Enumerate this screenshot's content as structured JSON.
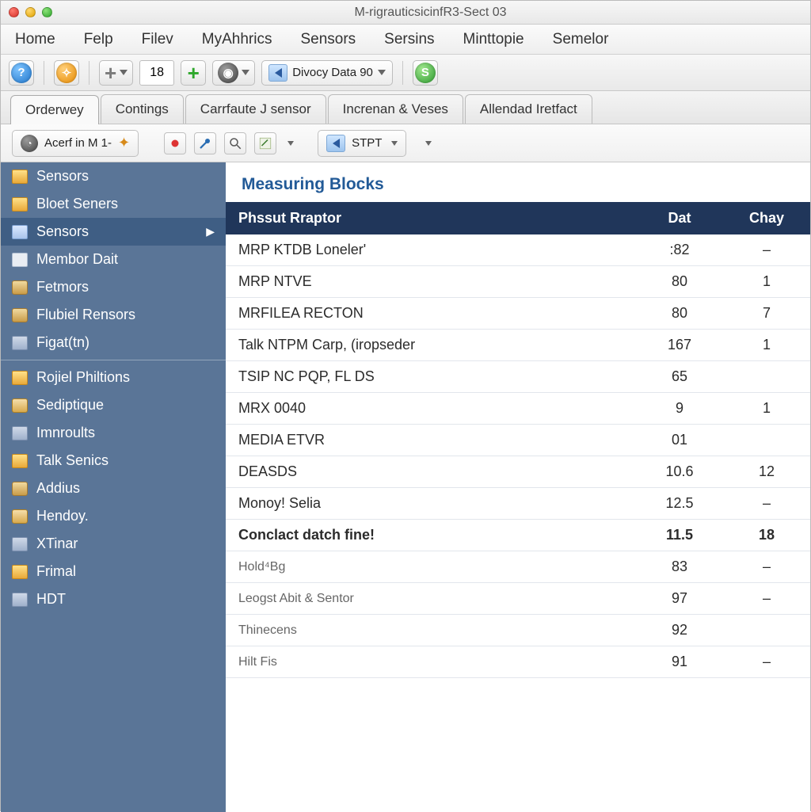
{
  "window": {
    "title": "M-rigrauticsicinfR3-Sect 03"
  },
  "menubar": [
    "Home",
    "Felp",
    "Filev",
    "MyAhhrics",
    "Sensors",
    "Sersins",
    "Minttopie",
    "Semelor"
  ],
  "toolbar1": {
    "step_value": "18",
    "data_dropdown": "Divocy Data 90"
  },
  "tabs": [
    {
      "label": "Orderwey",
      "active": true
    },
    {
      "label": "Contings",
      "active": false
    },
    {
      "label": "Carrfaute J sensor",
      "active": false
    },
    {
      "label": "Increnan & Veses",
      "active": false
    },
    {
      "label": "Allendad Iretfact",
      "active": false
    }
  ],
  "toolbar2": {
    "context_label": "Acerf in M 1-",
    "stpt_label": "STPT"
  },
  "sidebar": {
    "groups": [
      [
        {
          "label": "Sensors",
          "icon": "folder-y",
          "selected": false,
          "expand": false
        },
        {
          "label": "Bloet Seners",
          "icon": "folder-y",
          "selected": false,
          "expand": false
        },
        {
          "label": "Sensors",
          "icon": "folder-b",
          "selected": true,
          "expand": true
        },
        {
          "label": "Membor Dait",
          "icon": "doc",
          "selected": false,
          "expand": false
        },
        {
          "label": "Fetmors",
          "icon": "cube",
          "selected": false,
          "expand": false
        },
        {
          "label": "Flubiel Rensors",
          "icon": "cube",
          "selected": false,
          "expand": false
        },
        {
          "label": "Figat(tn)",
          "icon": "stack",
          "selected": false,
          "expand": false
        }
      ],
      [
        {
          "label": "Rojiel Philtions",
          "icon": "folder-y",
          "selected": false,
          "expand": false
        },
        {
          "label": "Sediptique",
          "icon": "lock",
          "selected": false,
          "expand": false
        },
        {
          "label": "Imnroults",
          "icon": "stack",
          "selected": false,
          "expand": false
        },
        {
          "label": "Talk Senics",
          "icon": "folder-y",
          "selected": false,
          "expand": false
        },
        {
          "label": "Addius",
          "icon": "cube",
          "selected": false,
          "expand": false
        },
        {
          "label": "Hendoy.",
          "icon": "lock",
          "selected": false,
          "expand": false
        },
        {
          "label": "XTinar",
          "icon": "stack",
          "selected": false,
          "expand": false
        },
        {
          "label": "Frimal",
          "icon": "folder-y",
          "selected": false,
          "expand": false
        },
        {
          "label": "HDT",
          "icon": "stack",
          "selected": false,
          "expand": false
        }
      ]
    ]
  },
  "main": {
    "heading": "Measuring Blocks",
    "columns": [
      "Phssut Rraptor",
      "Dat",
      "Chay"
    ],
    "rows": [
      {
        "name": "MRP KTDB Loneler'",
        "dat": ":82",
        "chay": "–",
        "sub": false,
        "bold": false
      },
      {
        "name": "MRP NTVE",
        "dat": "80",
        "chay": "1",
        "sub": false,
        "bold": false
      },
      {
        "name": "MRFILEA RECTON",
        "dat": "80",
        "chay": "7",
        "sub": false,
        "bold": false
      },
      {
        "name": "Talk NTPM Carp, (iropseder",
        "dat": "167",
        "chay": "1",
        "sub": false,
        "bold": false
      },
      {
        "name": "TSIP NC PQP, FL DS",
        "dat": "65",
        "chay": "",
        "sub": false,
        "bold": false
      },
      {
        "name": "MRX 0040",
        "dat": "9",
        "chay": "1",
        "sub": false,
        "bold": false
      },
      {
        "name": "MEDIA ETVR",
        "dat": "01",
        "chay": "",
        "sub": false,
        "bold": false
      },
      {
        "name": "DEASDS",
        "dat": "10.6",
        "chay": "12",
        "sub": false,
        "bold": false
      },
      {
        "name": "Monoy! Selia",
        "dat": "12.5",
        "chay": "–",
        "sub": false,
        "bold": false
      },
      {
        "name": "Conclact datch fine!",
        "dat": "11.5",
        "chay": "18",
        "sub": false,
        "bold": true
      },
      {
        "name": "Hold⁴Bg",
        "dat": "83",
        "chay": "–",
        "sub": true,
        "bold": false
      },
      {
        "name": "Leogst Abit & Sentor",
        "dat": "97",
        "chay": "–",
        "sub": true,
        "bold": false
      },
      {
        "name": "Thinecens",
        "dat": "92",
        "chay": "",
        "sub": true,
        "bold": false
      },
      {
        "name": "Hilt Fis",
        "dat": "91",
        "chay": "–",
        "sub": true,
        "bold": false
      }
    ]
  }
}
